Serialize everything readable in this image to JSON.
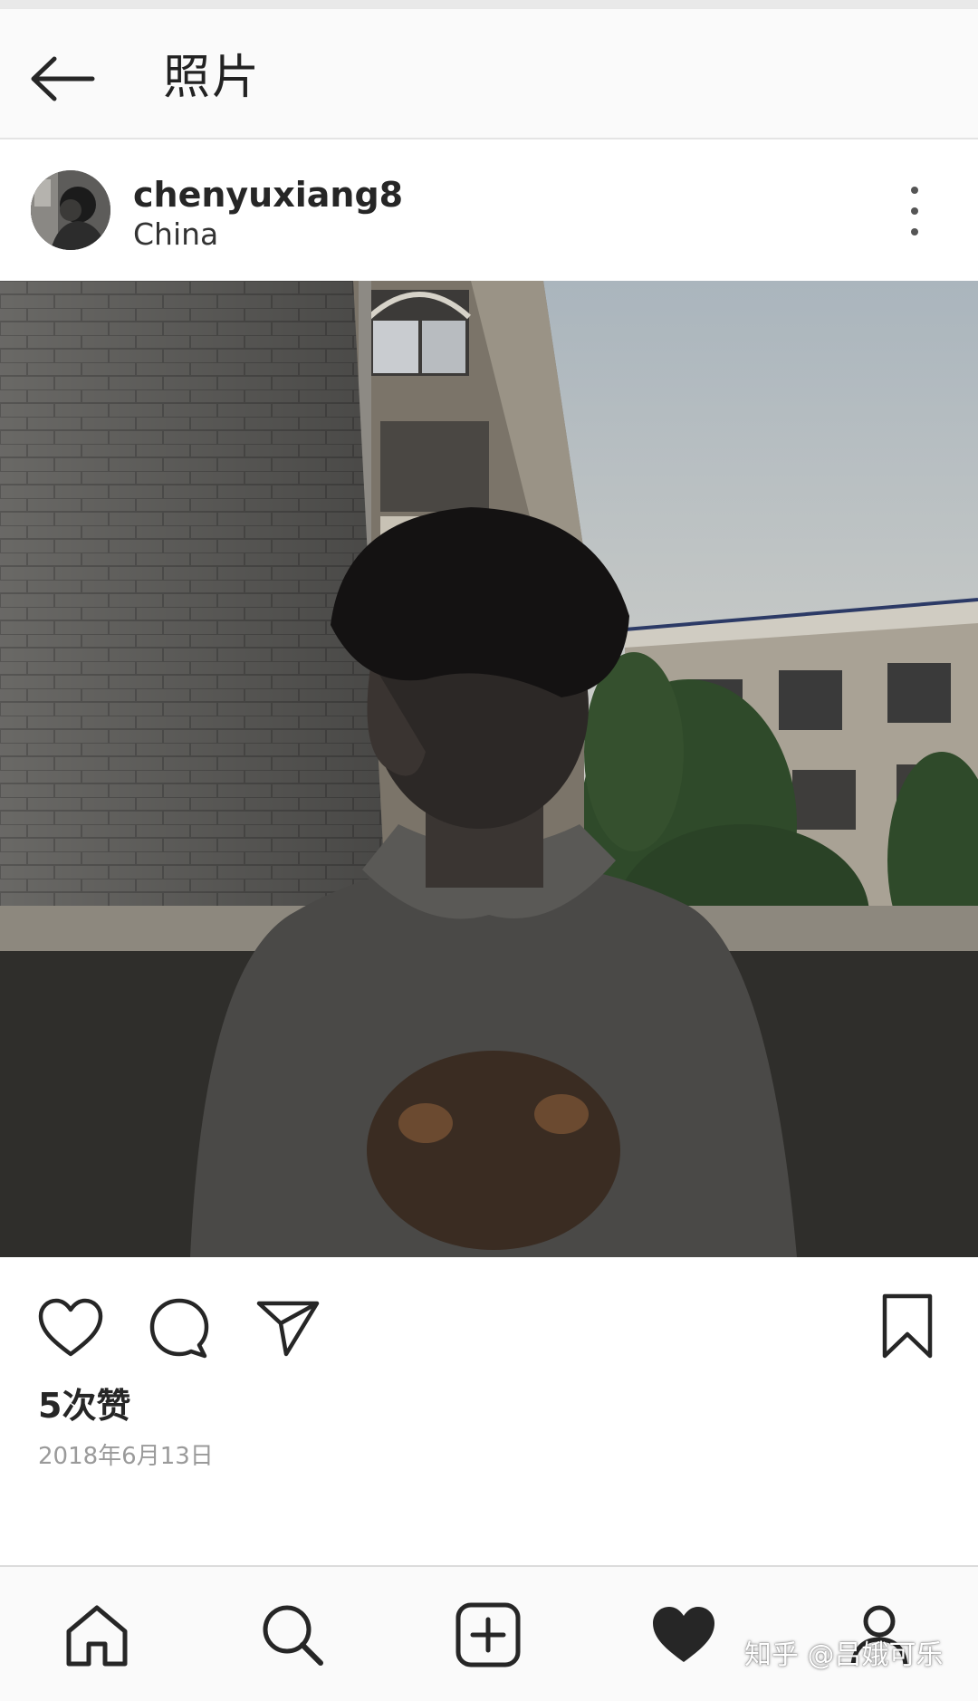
{
  "header": {
    "title": "照片",
    "back_icon": "arrow-left-icon"
  },
  "post": {
    "username": "chenyuxiang8",
    "location": "China",
    "avatar": "avatar",
    "more_icon": "more-vertical-icon",
    "likes_label": "5次赞",
    "date": "2018年6月13日"
  },
  "actions": {
    "like_icon": "heart-outline-icon",
    "comment_icon": "comment-icon",
    "share_icon": "send-icon",
    "save_icon": "bookmark-icon"
  },
  "bottom_nav": {
    "items": [
      {
        "name": "home",
        "icon": "home-icon"
      },
      {
        "name": "search",
        "icon": "search-icon"
      },
      {
        "name": "new-post",
        "icon": "add-square-icon"
      },
      {
        "name": "activity",
        "icon": "heart-filled-icon"
      },
      {
        "name": "profile",
        "icon": "profile-icon"
      }
    ]
  },
  "watermark": "知乎 @吕娥可乐",
  "colors": {
    "text": "#262626",
    "muted": "#9a9a9a",
    "bar_bg": "#fafafa",
    "divider": "#e4e4e4"
  }
}
